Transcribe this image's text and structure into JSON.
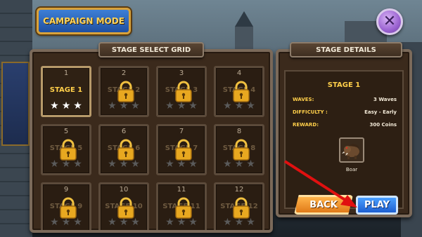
{
  "header": {
    "campaign_title": "CAMPAIGN MODE",
    "close_icon": "close-icon"
  },
  "grid": {
    "title": "STAGE SELECT GRID",
    "stages": [
      {
        "number": "1",
        "label": "STAGE 1",
        "locked": false,
        "stars": 3
      },
      {
        "number": "2",
        "label": "STAGE 2",
        "locked": true,
        "stars": 0
      },
      {
        "number": "3",
        "label": "STAGE 3",
        "locked": true,
        "stars": 0
      },
      {
        "number": "4",
        "label": "STAGE 4",
        "locked": true,
        "stars": 0
      },
      {
        "number": "5",
        "label": "STAGE 5",
        "locked": true,
        "stars": 0
      },
      {
        "number": "6",
        "label": "STAGE 6",
        "locked": true,
        "stars": 0
      },
      {
        "number": "7",
        "label": "STAGE 7",
        "locked": true,
        "stars": 0
      },
      {
        "number": "8",
        "label": "STAGE 8",
        "locked": true,
        "stars": 0
      },
      {
        "number": "9",
        "label": "STAGE 9",
        "locked": true,
        "stars": 0
      },
      {
        "number": "10",
        "label": "STAGE 10",
        "locked": true,
        "stars": 0
      },
      {
        "number": "11",
        "label": "STAGE 11",
        "locked": true,
        "stars": 0
      },
      {
        "number": "12",
        "label": "STAGE 12",
        "locked": true,
        "stars": 0
      }
    ]
  },
  "details": {
    "title": "STAGE DETAILS",
    "stage_name": "STAGE 1",
    "waves_label": "WAVES:",
    "waves_value": "3 Waves",
    "difficulty_label": "DIFFICULTY :",
    "difficulty_value": "Easy - Early",
    "reward_label": "REWARD:",
    "reward_value": "300 Coins",
    "enemy_icon": "boar-icon",
    "enemy_name": "Boar"
  },
  "buttons": {
    "back_label": "BACK",
    "play_label": "PLAY"
  },
  "colors": {
    "accent_gold": "#ffcf4a",
    "panel_brown": "#3b2a1c",
    "play_blue": "#1d5ed0",
    "back_orange": "#e07a18",
    "arrow_red": "#e01010"
  }
}
